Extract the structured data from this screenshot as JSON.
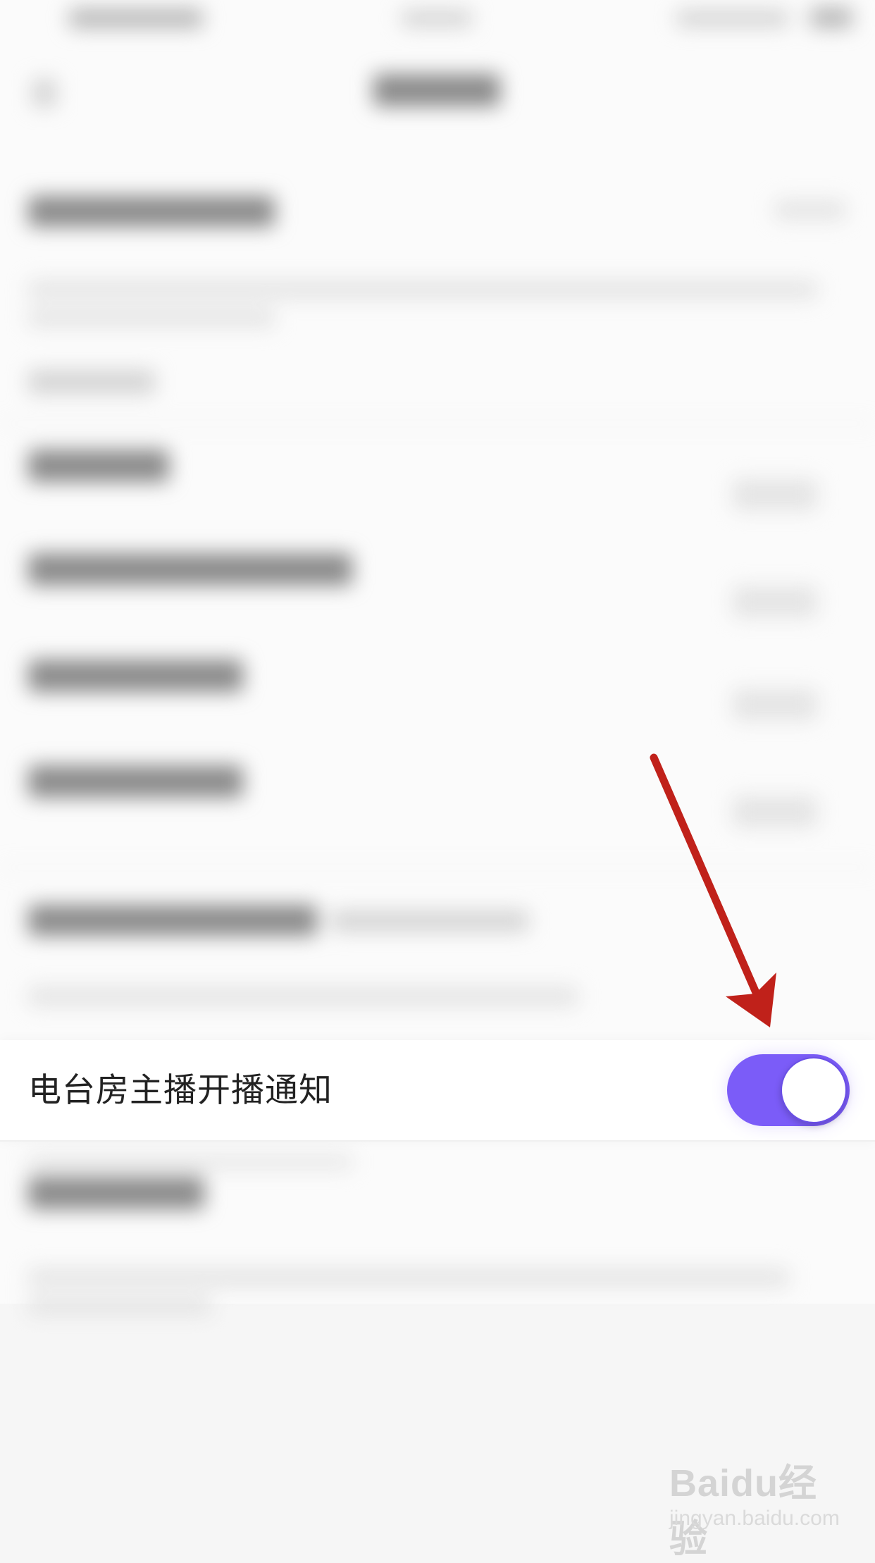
{
  "settings_row": {
    "label": "电台房主播开播通知",
    "toggle_on": true
  },
  "colors": {
    "toggle_accent": "#7b5cf8",
    "annotation_arrow": "#c0211a"
  },
  "watermark": {
    "brand": "Baidu经验",
    "url": "jingyan.baidu.com"
  }
}
